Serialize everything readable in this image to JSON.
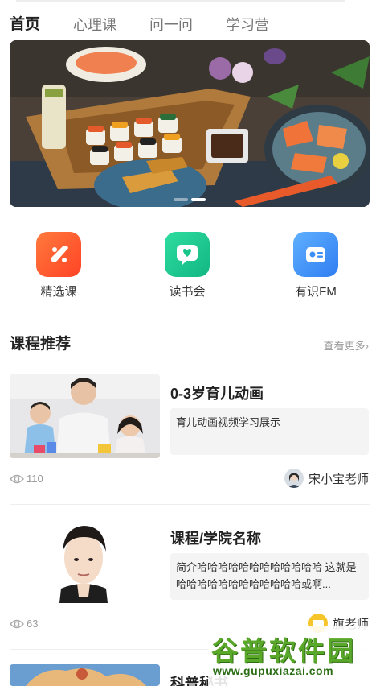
{
  "tabs": [
    {
      "label": "首页",
      "active": true
    },
    {
      "label": "心理课",
      "active": false
    },
    {
      "label": "问一问",
      "active": false
    },
    {
      "label": "学习营",
      "active": false
    }
  ],
  "banner": {
    "slides": 2,
    "active_slide": 2
  },
  "entries": [
    {
      "label": "精选课",
      "icon": "course-icon",
      "color": "#ff5a2c"
    },
    {
      "label": "读书会",
      "icon": "chat-heart-icon",
      "color": "#19c98f"
    },
    {
      "label": "有识FM",
      "icon": "radio-icon",
      "color": "#3d8ef7"
    }
  ],
  "section": {
    "title": "课程推荐",
    "more": "查看更多›"
  },
  "courses": [
    {
      "title": "0-3岁育儿动画",
      "desc": "育儿动画视频学习展示",
      "views": "110",
      "teacher": "宋小宝老师"
    },
    {
      "title": "课程/学院名称",
      "desc": "简介哈哈哈哈哈哈哈哈哈哈哈哈 这就是哈哈哈哈哈哈哈哈哈哈哈哈或啊...",
      "views": "63",
      "teacher": "旗老师"
    },
    {
      "title": "科普秘书"
    }
  ],
  "watermark": {
    "main": "谷普软件园",
    "url": "www.gupuxiazai.com"
  },
  "colors": {
    "accent": "#ffe31a",
    "text": "#333333",
    "muted": "#999999"
  }
}
